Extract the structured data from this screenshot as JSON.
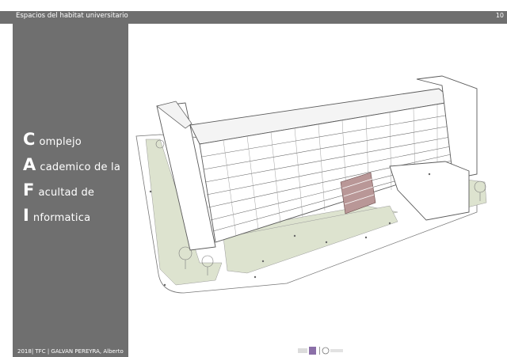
{
  "header": {
    "title": "Espacios del habitat universitario",
    "page_number": "10"
  },
  "title": {
    "lines": [
      {
        "initial": "C",
        "rest": "omplejo"
      },
      {
        "initial": "A",
        "rest": "cademico de la"
      },
      {
        "initial": "F",
        "rest": "acultad de"
      },
      {
        "initial": "I",
        "rest": "nformatica"
      }
    ]
  },
  "footer": {
    "credit": "2018| TFC | GALVAN PEREYRA, Alberto"
  },
  "colors": {
    "panel": "#6f6f6f",
    "lawn": "#dde3cf",
    "stair_accent": "#b99797",
    "building": "#ffffff",
    "line": "#5a5a5a"
  },
  "icons": [
    "architecture-illustration",
    "university-logo"
  ]
}
